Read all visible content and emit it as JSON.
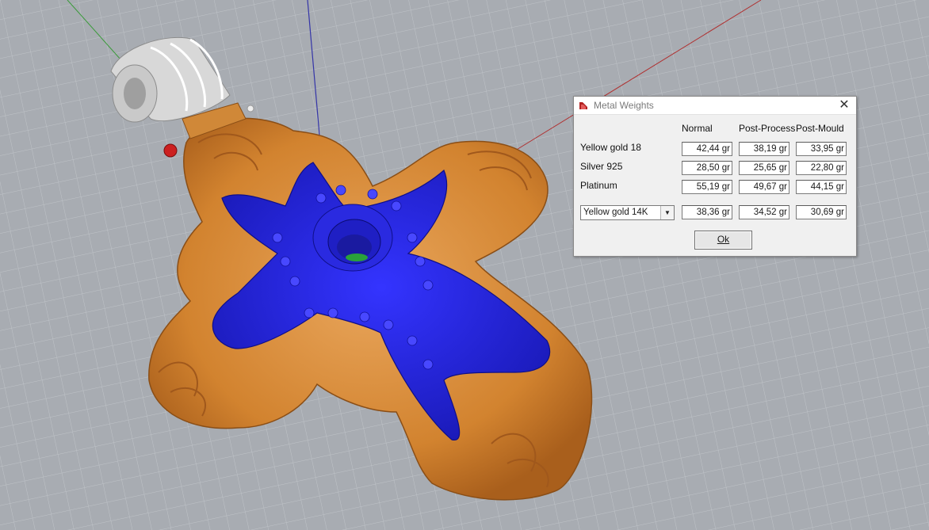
{
  "dialog": {
    "title": "Metal Weights",
    "close_glyph": "✕",
    "columns": [
      "Normal",
      "Post-Process",
      "Post-Mould"
    ],
    "rows": [
      {
        "label": "Yellow gold 18",
        "values": [
          "42,44 gr",
          "38,19 gr",
          "33,95 gr"
        ]
      },
      {
        "label": "Silver 925",
        "values": [
          "28,50 gr",
          "25,65 gr",
          "22,80 gr"
        ]
      },
      {
        "label": "Platinum",
        "values": [
          "55,19 gr",
          "49,67 gr",
          "44,15 gr"
        ]
      }
    ],
    "custom_metal": {
      "selected": "Yellow gold 14K",
      "values": [
        "38,36 gr",
        "34,52 gr",
        "30,69 gr"
      ]
    },
    "ok_label": "Ok"
  },
  "viewport": {
    "model": "cross pendant",
    "colors": {
      "background": "#a8acb2",
      "grid": "#bcc0c5",
      "gold": "#d98a3e",
      "blue_inlay": "#2222dd",
      "axis_x": "#b03030",
      "axis_y": "#3a9a3a",
      "axis_z": "#3434a8"
    }
  }
}
